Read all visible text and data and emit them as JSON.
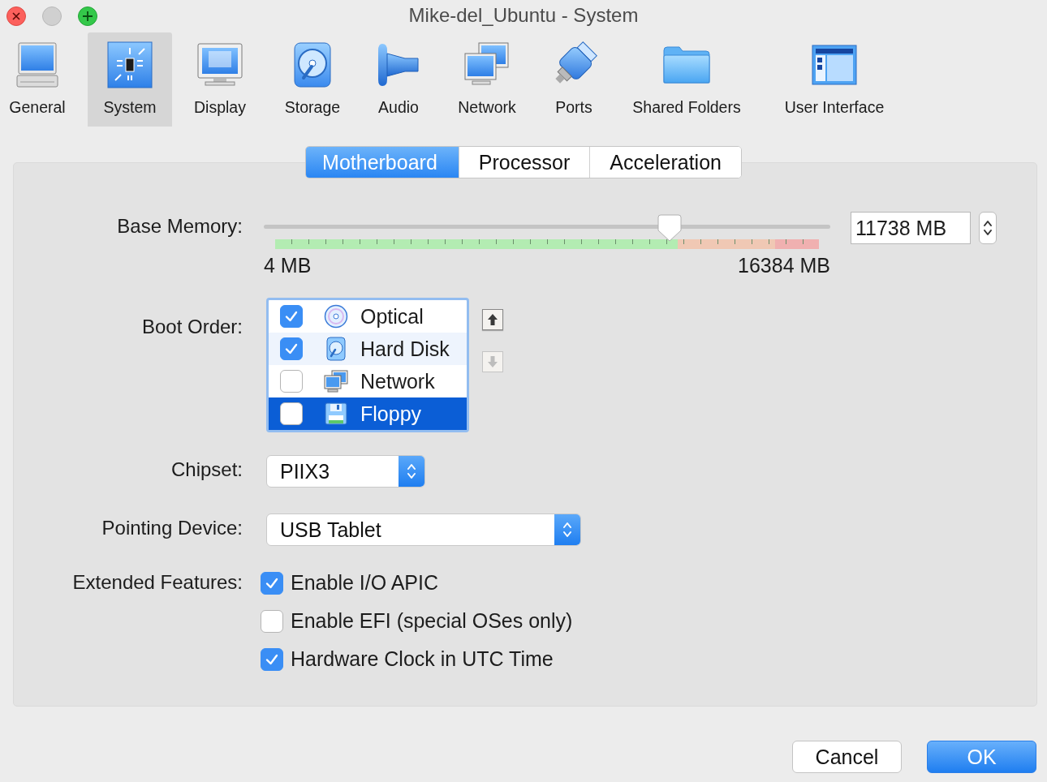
{
  "window": {
    "title": "Mike-del_Ubuntu - System"
  },
  "toolbar": [
    {
      "label": "General",
      "selected": false
    },
    {
      "label": "System",
      "selected": true
    },
    {
      "label": "Display",
      "selected": false
    },
    {
      "label": "Storage",
      "selected": false
    },
    {
      "label": "Audio",
      "selected": false
    },
    {
      "label": "Network",
      "selected": false
    },
    {
      "label": "Ports",
      "selected": false
    },
    {
      "label": "Shared Folders",
      "selected": false
    },
    {
      "label": "User Interface",
      "selected": false
    }
  ],
  "tabs": [
    {
      "label": "Motherboard",
      "selected": true
    },
    {
      "label": "Processor",
      "selected": false
    },
    {
      "label": "Acceleration",
      "selected": false
    }
  ],
  "base_memory": {
    "label": "Base Memory:",
    "level": 0.716,
    "value": "11738 MB",
    "min_label": "4 MB",
    "max_label": "16384 MB"
  },
  "boot_order": {
    "label": "Boot Order:",
    "items": [
      {
        "label": "Optical",
        "checked": true,
        "selected": false
      },
      {
        "label": "Hard Disk",
        "checked": true,
        "selected": false
      },
      {
        "label": "Network",
        "checked": false,
        "selected": false
      },
      {
        "label": "Floppy",
        "checked": false,
        "selected": true
      }
    ],
    "move_up": {
      "disabled": false
    },
    "move_down": {
      "disabled": true
    }
  },
  "chipset": {
    "label": "Chipset:",
    "value": "PIIX3"
  },
  "pointing_device": {
    "label": "Pointing Device:",
    "value": "USB Tablet"
  },
  "extended_features": {
    "label": "Extended Features:",
    "options": [
      {
        "label": "Enable I/O APIC",
        "checked": true
      },
      {
        "label": "Enable EFI (special OSes only)",
        "checked": false
      },
      {
        "label": "Hardware Clock in UTC Time",
        "checked": true
      }
    ]
  },
  "buttons": [
    {
      "label": "Cancel",
      "default": false
    },
    {
      "label": "OK",
      "default": true
    }
  ]
}
